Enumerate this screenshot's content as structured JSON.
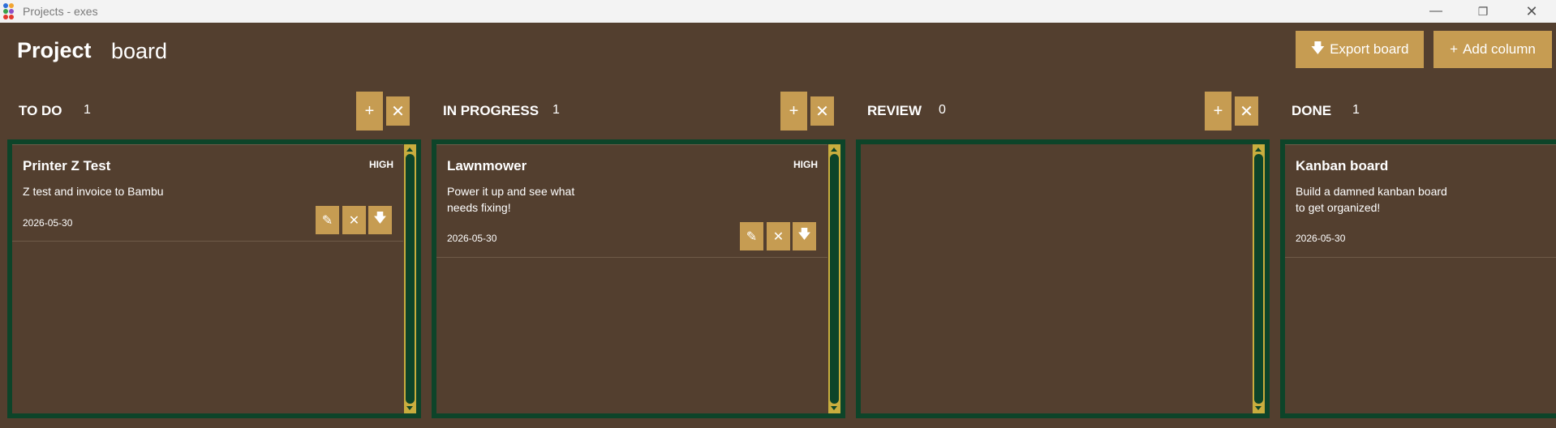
{
  "window": {
    "title": "Projects - exes",
    "minimize_icon": "minimize-icon",
    "restore_icon": "restore-icon",
    "close_icon": "close-icon"
  },
  "header": {
    "title": "Project",
    "subtitle": "board",
    "export_label": "Export board",
    "add_column_label": "Add column"
  },
  "colors": {
    "background": "#533f2f",
    "accent": "#c69c52",
    "column_border": "#0d4429",
    "scrollbar": "#c9ad3e"
  },
  "columns": [
    {
      "name": "TO DO",
      "count": "1",
      "cards": [
        {
          "title": "Printer Z Test",
          "priority": "HIGH",
          "description": "Z test and invoice to Bambu",
          "date": "2026-05-30"
        }
      ]
    },
    {
      "name": "IN PROGRESS",
      "count": "1",
      "cards": [
        {
          "title": "Lawnmower",
          "priority": "HIGH",
          "description": "Power it up and see what needs fixing!",
          "date": "2026-05-30"
        }
      ]
    },
    {
      "name": "REVIEW",
      "count": "0",
      "cards": []
    },
    {
      "name": "DONE",
      "count": "1",
      "cards": [
        {
          "title": "Kanban board",
          "priority": "",
          "description": "Build a damned kanban board to get organized!",
          "date": "2026-05-30"
        }
      ]
    }
  ],
  "icons": {
    "add": "plus-icon",
    "delete": "close-icon",
    "edit": "pencil-icon",
    "move": "arrow-down-icon",
    "export": "download-icon"
  }
}
